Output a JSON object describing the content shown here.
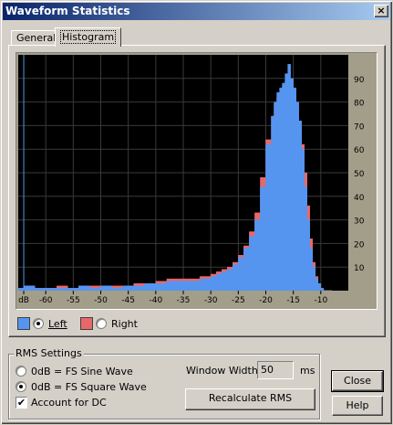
{
  "window": {
    "title": "Waveform Statistics",
    "close_glyph": "×"
  },
  "tabs": [
    {
      "label": "General"
    },
    {
      "label": "Histogram"
    }
  ],
  "legend": {
    "left": {
      "label": "Left",
      "color": "#5595f0",
      "selected": true
    },
    "right": {
      "label": "Right",
      "color": "#e8686a",
      "selected": false
    }
  },
  "chart_data": {
    "type": "area",
    "title": "",
    "xlabel": "dB",
    "ylabel": "",
    "x_ticks": [
      "dB",
      "-60",
      "-55",
      "-50",
      "-45",
      "-40",
      "-35",
      "-30",
      "-25",
      "-20",
      "-15",
      "-10"
    ],
    "y_ticks": [
      "10",
      "20",
      "30",
      "40",
      "50",
      "60",
      "70",
      "80",
      "90"
    ],
    "xlim": [
      -65,
      -5
    ],
    "ylim": [
      0,
      100
    ],
    "grid": true,
    "background": "#000000",
    "marker_line_x": -64,
    "series": [
      {
        "name": "Left",
        "color": "#5595f0",
        "x": [
          -65,
          -64,
          -62,
          -60,
          -58,
          -56,
          -54,
          -52,
          -50,
          -48,
          -46,
          -44,
          -42,
          -40,
          -38,
          -36,
          -34,
          -32,
          -30,
          -29,
          -28,
          -27,
          -26,
          -25,
          -24,
          -23,
          -22,
          -21,
          -20,
          -19,
          -18.5,
          -18,
          -17.5,
          -17,
          -16.5,
          -16,
          -15.5,
          -15,
          -14.5,
          -14,
          -13.5,
          -13,
          -12.5,
          -12,
          -11.5,
          -11,
          -10.5,
          -10,
          -9.5,
          -9,
          -8
        ],
        "values": [
          1,
          2,
          1,
          1,
          1,
          1,
          2,
          1,
          2,
          1,
          2,
          2,
          3,
          3,
          4,
          4,
          4,
          5,
          6,
          7,
          8,
          9,
          11,
          14,
          18,
          23,
          30,
          44,
          62,
          74,
          80,
          84,
          86,
          88,
          92,
          96,
          90,
          86,
          80,
          72,
          60,
          44,
          30,
          18,
          10,
          5,
          3,
          1,
          0,
          0,
          0
        ]
      },
      {
        "name": "Right",
        "color": "#e8686a",
        "x": [
          -65,
          -64,
          -62,
          -60,
          -58,
          -56,
          -54,
          -52,
          -50,
          -48,
          -46,
          -44,
          -42,
          -40,
          -38,
          -36,
          -34,
          -32,
          -30,
          -29,
          -28,
          -27,
          -26,
          -25,
          -24,
          -23,
          -22,
          -21,
          -20,
          -19,
          -18.5,
          -18,
          -17.5,
          -17,
          -16.5,
          -16,
          -15.5,
          -15,
          -14.5,
          -14,
          -13.5,
          -13,
          -12.5,
          -12,
          -11.5,
          -11,
          -10.5,
          -10,
          -9.5,
          -9,
          -8
        ],
        "values": [
          1,
          2,
          1,
          1,
          2,
          1,
          2,
          2,
          2,
          2,
          2,
          3,
          3,
          4,
          5,
          5,
          5,
          6,
          7,
          8,
          9,
          10,
          12,
          15,
          19,
          25,
          33,
          48,
          64,
          74,
          79,
          82,
          84,
          87,
          89,
          88,
          86,
          84,
          78,
          70,
          62,
          50,
          36,
          22,
          12,
          6,
          3,
          1,
          0,
          0,
          0
        ]
      }
    ]
  },
  "rms": {
    "group_title": "RMS Settings",
    "sine_label": "0dB = FS Sine Wave",
    "square_label": "0dB = FS Square Wave",
    "sine_selected": false,
    "square_selected": true,
    "dc_label": "Account for DC",
    "dc_checked": true,
    "dc_check_glyph": "✔",
    "window_width_label": "Window Width:",
    "window_width_value": "50",
    "window_width_unit": "ms",
    "recalc_label": "Recalculate RMS"
  },
  "buttons": {
    "close": "Close",
    "help": "Help"
  }
}
